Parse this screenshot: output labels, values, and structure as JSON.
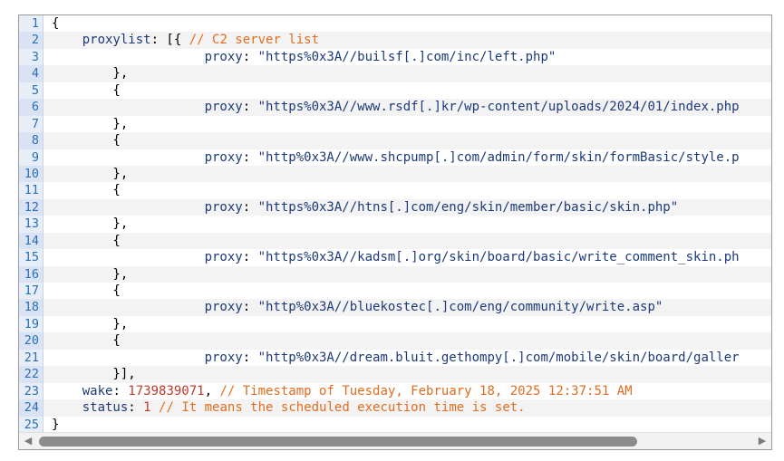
{
  "editor": {
    "lines": [
      {
        "num": "1",
        "parts": [
          {
            "t": "p",
            "v": "{"
          }
        ]
      },
      {
        "num": "2",
        "parts": [
          {
            "t": "k",
            "v": "    proxylist"
          },
          {
            "t": "p",
            "v": ": [{ "
          },
          {
            "t": "c",
            "v": "// C2 server list"
          }
        ]
      },
      {
        "num": "3",
        "parts": [
          {
            "t": "k",
            "v": "                    proxy"
          },
          {
            "t": "p",
            "v": ": "
          },
          {
            "t": "s",
            "v": "\"https%0x3A//builsf[.]com/inc/left.php\""
          }
        ]
      },
      {
        "num": "4",
        "parts": [
          {
            "t": "p",
            "v": "        },"
          }
        ]
      },
      {
        "num": "5",
        "parts": [
          {
            "t": "p",
            "v": "        {"
          }
        ]
      },
      {
        "num": "6",
        "parts": [
          {
            "t": "k",
            "v": "                    proxy"
          },
          {
            "t": "p",
            "v": ": "
          },
          {
            "t": "s",
            "v": "\"https%0x3A//www.rsdf[.]kr/wp-content/uploads/2024/01/index.php"
          }
        ]
      },
      {
        "num": "7",
        "parts": [
          {
            "t": "p",
            "v": "        },"
          }
        ]
      },
      {
        "num": "8",
        "parts": [
          {
            "t": "p",
            "v": "        {"
          }
        ]
      },
      {
        "num": "9",
        "parts": [
          {
            "t": "k",
            "v": "                    proxy"
          },
          {
            "t": "p",
            "v": ": "
          },
          {
            "t": "s",
            "v": "\"http%0x3A//www.shcpump[.]com/admin/form/skin/formBasic/style.p"
          }
        ]
      },
      {
        "num": "10",
        "parts": [
          {
            "t": "p",
            "v": "        },"
          }
        ]
      },
      {
        "num": "11",
        "parts": [
          {
            "t": "p",
            "v": "        {"
          }
        ]
      },
      {
        "num": "12",
        "parts": [
          {
            "t": "k",
            "v": "                    proxy"
          },
          {
            "t": "p",
            "v": ": "
          },
          {
            "t": "s",
            "v": "\"https%0x3A//htns[.]com/eng/skin/member/basic/skin.php\""
          }
        ]
      },
      {
        "num": "13",
        "parts": [
          {
            "t": "p",
            "v": "        },"
          }
        ]
      },
      {
        "num": "14",
        "parts": [
          {
            "t": "p",
            "v": "        {"
          }
        ]
      },
      {
        "num": "15",
        "parts": [
          {
            "t": "k",
            "v": "                    proxy"
          },
          {
            "t": "p",
            "v": ": "
          },
          {
            "t": "s",
            "v": "\"https%0x3A//kadsm[.]org/skin/board/basic/write_comment_skin.ph"
          }
        ]
      },
      {
        "num": "16",
        "parts": [
          {
            "t": "p",
            "v": "        },"
          }
        ]
      },
      {
        "num": "17",
        "parts": [
          {
            "t": "p",
            "v": "        {"
          }
        ]
      },
      {
        "num": "18",
        "parts": [
          {
            "t": "k",
            "v": "                    proxy"
          },
          {
            "t": "p",
            "v": ": "
          },
          {
            "t": "s",
            "v": "\"http%0x3A//bluekostec[.]com/eng/community/write.asp\""
          }
        ]
      },
      {
        "num": "19",
        "parts": [
          {
            "t": "p",
            "v": "        },"
          }
        ]
      },
      {
        "num": "20",
        "parts": [
          {
            "t": "p",
            "v": "        {"
          }
        ]
      },
      {
        "num": "21",
        "parts": [
          {
            "t": "k",
            "v": "                    proxy"
          },
          {
            "t": "p",
            "v": ": "
          },
          {
            "t": "s",
            "v": "\"http%0x3A//dream.bluit.gethompy[.]com/mobile/skin/board/galler"
          }
        ]
      },
      {
        "num": "22",
        "parts": [
          {
            "t": "p",
            "v": "        }],"
          }
        ]
      },
      {
        "num": "23",
        "parts": [
          {
            "t": "k",
            "v": "    wake"
          },
          {
            "t": "p",
            "v": ": "
          },
          {
            "t": "n",
            "v": "1739839071"
          },
          {
            "t": "p",
            "v": ", "
          },
          {
            "t": "c",
            "v": "// Timestamp of Tuesday, February 18, 2025 12:37:51 AM"
          }
        ]
      },
      {
        "num": "24",
        "parts": [
          {
            "t": "k",
            "v": "    status"
          },
          {
            "t": "p",
            "v": ": "
          },
          {
            "t": "n",
            "v": "1"
          },
          {
            "t": "p",
            "v": " "
          },
          {
            "t": "c",
            "v": "// It means the scheduled execution time is set."
          }
        ]
      },
      {
        "num": "25",
        "parts": [
          {
            "t": "p",
            "v": "}"
          }
        ]
      }
    ]
  },
  "scrollbar": {
    "left_icon": "triangle-left-icon",
    "right_icon": "triangle-right-icon",
    "left_glyph": "◀",
    "right_glyph": "▶",
    "position_fraction": 0.0,
    "visible_fraction": 0.84
  },
  "colors": {
    "key": "#1c3a7a",
    "number": "#c0392b",
    "comment": "#e06d1f",
    "gutter_text": "#2b6fb5"
  }
}
